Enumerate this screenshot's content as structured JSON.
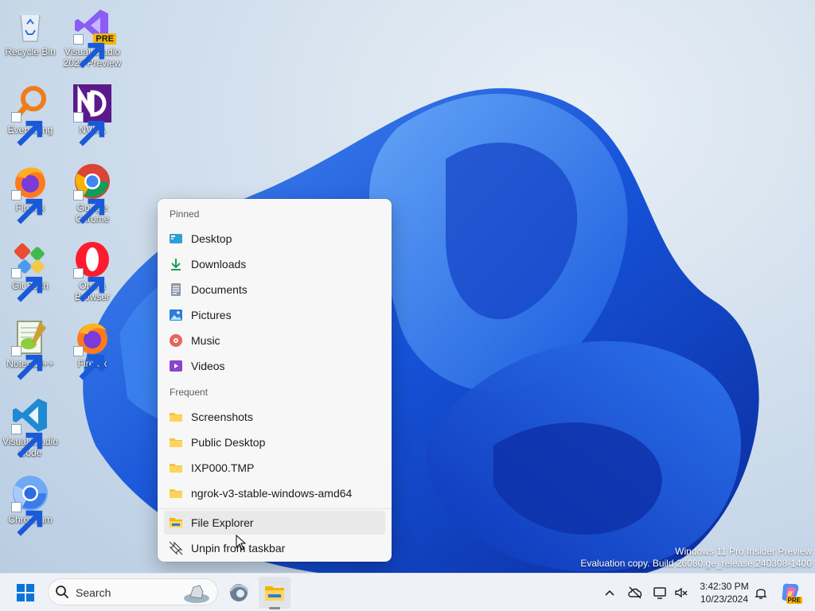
{
  "desktop": {
    "icons": [
      {
        "label": "Recycle Bin"
      },
      {
        "label": "Visual Studio 2022 Preview",
        "badge": "PRE"
      },
      {
        "label": "Everything"
      },
      {
        "label": "NVDA"
      },
      {
        "label": "Firefox"
      },
      {
        "label": "Google Chrome"
      },
      {
        "label": "Git Bash"
      },
      {
        "label": "Opera Browser"
      },
      {
        "label": "Notepad++"
      },
      {
        "label": "Firefox"
      },
      {
        "label": "Visual Studio Code"
      },
      {
        "label": "Chromium"
      }
    ]
  },
  "jumplist": {
    "pinned_header": "Pinned",
    "pinned": [
      {
        "label": "Desktop",
        "icon": "desktop-folder-icon"
      },
      {
        "label": "Downloads",
        "icon": "downloads-icon"
      },
      {
        "label": "Documents",
        "icon": "documents-icon"
      },
      {
        "label": "Pictures",
        "icon": "pictures-icon"
      },
      {
        "label": "Music",
        "icon": "music-icon"
      },
      {
        "label": "Videos",
        "icon": "videos-icon"
      }
    ],
    "frequent_header": "Frequent",
    "frequent": [
      {
        "label": "Screenshots",
        "icon": "folder-icon"
      },
      {
        "label": "Public Desktop",
        "icon": "folder-icon"
      },
      {
        "label": "IXP000.TMP",
        "icon": "folder-icon"
      },
      {
        "label": "ngrok-v3-stable-windows-amd64",
        "icon": "folder-icon"
      }
    ],
    "actions": [
      {
        "label": "File Explorer",
        "icon": "file-explorer-icon"
      },
      {
        "label": "Unpin from taskbar",
        "icon": "unpin-icon"
      }
    ]
  },
  "watermark": {
    "line1": "Windows 11 Pro Insider Preview",
    "line2": "Evaluation copy. Build 26080.ge_release.240308-1400"
  },
  "taskbar": {
    "search_placeholder": "Search",
    "clock_time": "3:42:30 PM",
    "clock_date": "10/23/2024",
    "copilot_badge": "PRE"
  },
  "colors": {
    "accent": "#0067c0",
    "folder": "#f5c242"
  }
}
